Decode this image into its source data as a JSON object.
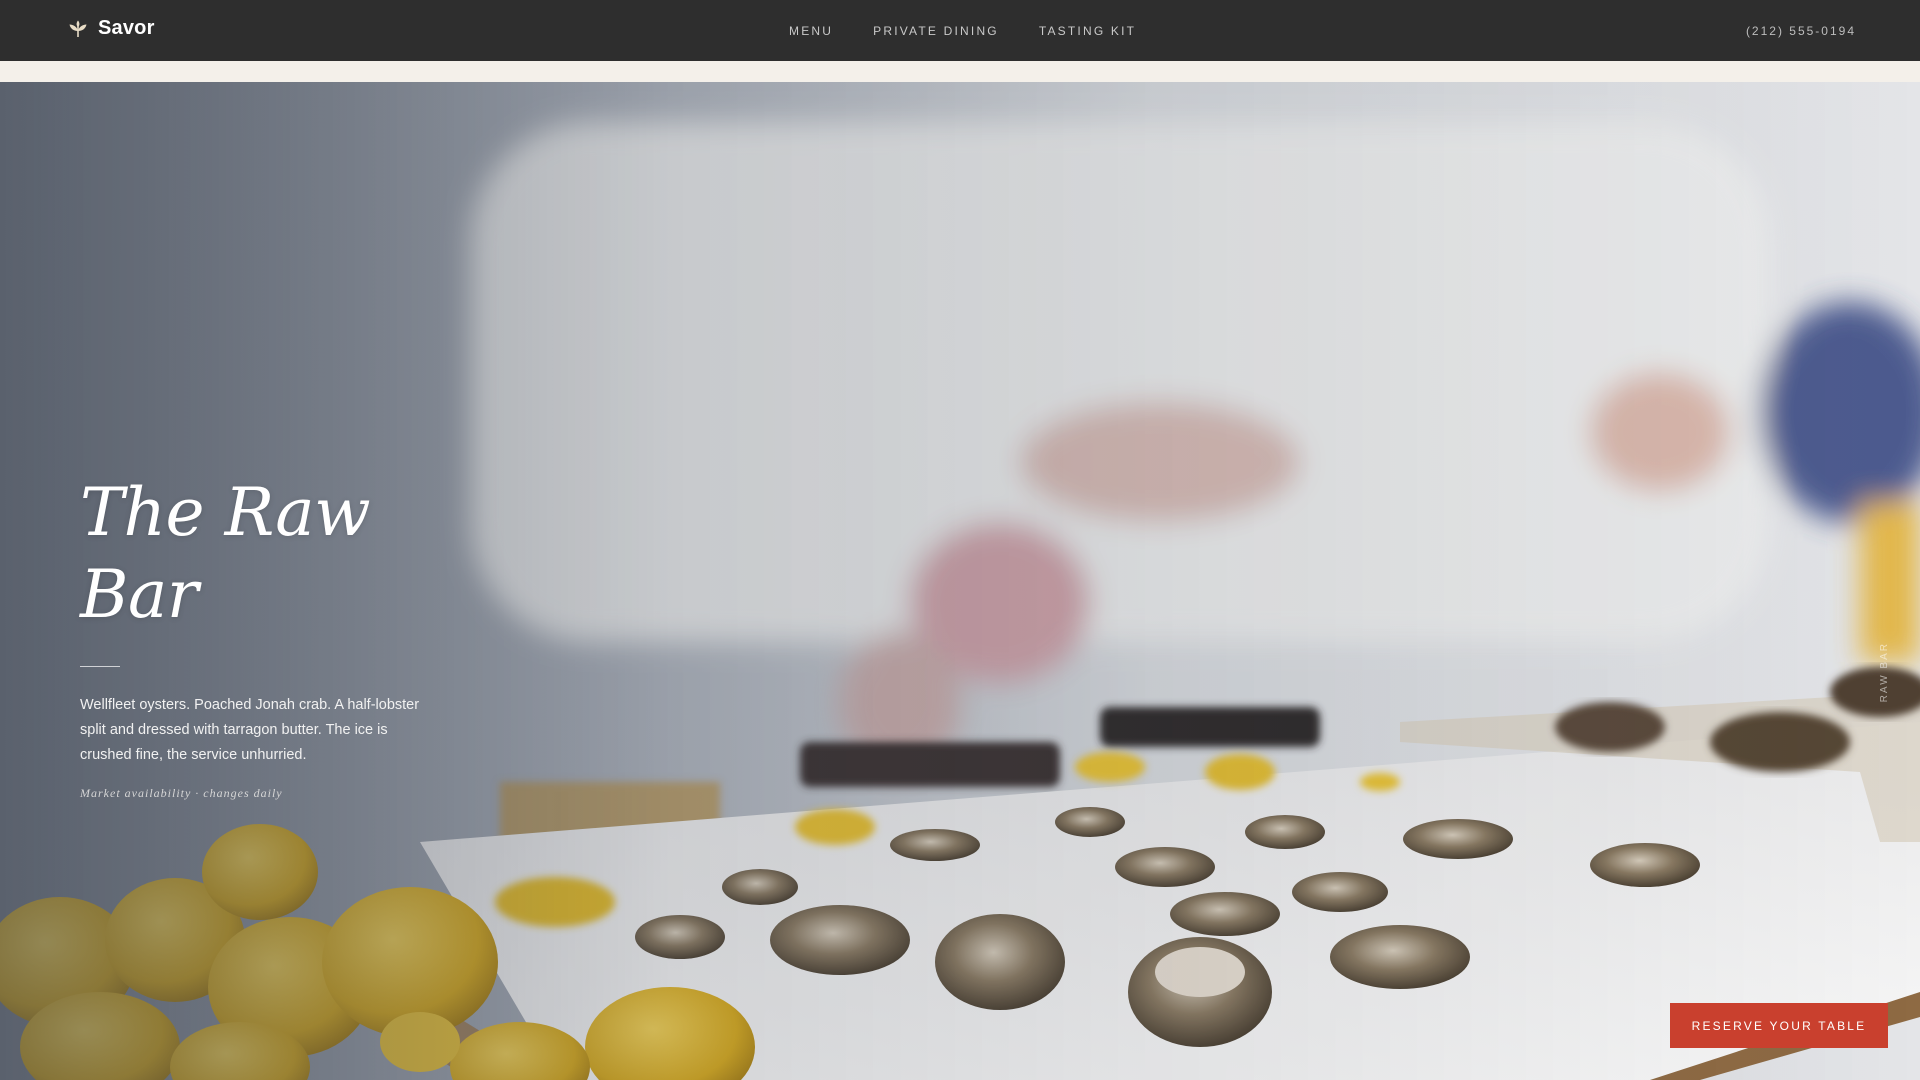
{
  "brand": {
    "name": "Savor",
    "icon": "leaf-sprout-icon"
  },
  "nav": {
    "items": [
      {
        "label": "MENU"
      },
      {
        "label": "PRIVATE DINING"
      },
      {
        "label": "TASTING KIT"
      }
    ],
    "phone": "(212) 555-0194"
  },
  "hero": {
    "title_line1": "The Raw",
    "title_line2": "Bar",
    "description": "Wellfleet oysters. Poached Jonah crab. A half-lobster split and dressed with tarragon butter. The ice is crushed fine, the service unhurried.",
    "note": "Market availability · changes daily",
    "vertical_label": "RAW BAR",
    "image": "oysters on crushed ice with lemons, chefs in background"
  },
  "cta": {
    "label": "RESERVE YOUR TABLE"
  },
  "colors": {
    "topbar": "#2e2e2e",
    "strip": "#f4f0ea",
    "accent": "#c9402e"
  }
}
